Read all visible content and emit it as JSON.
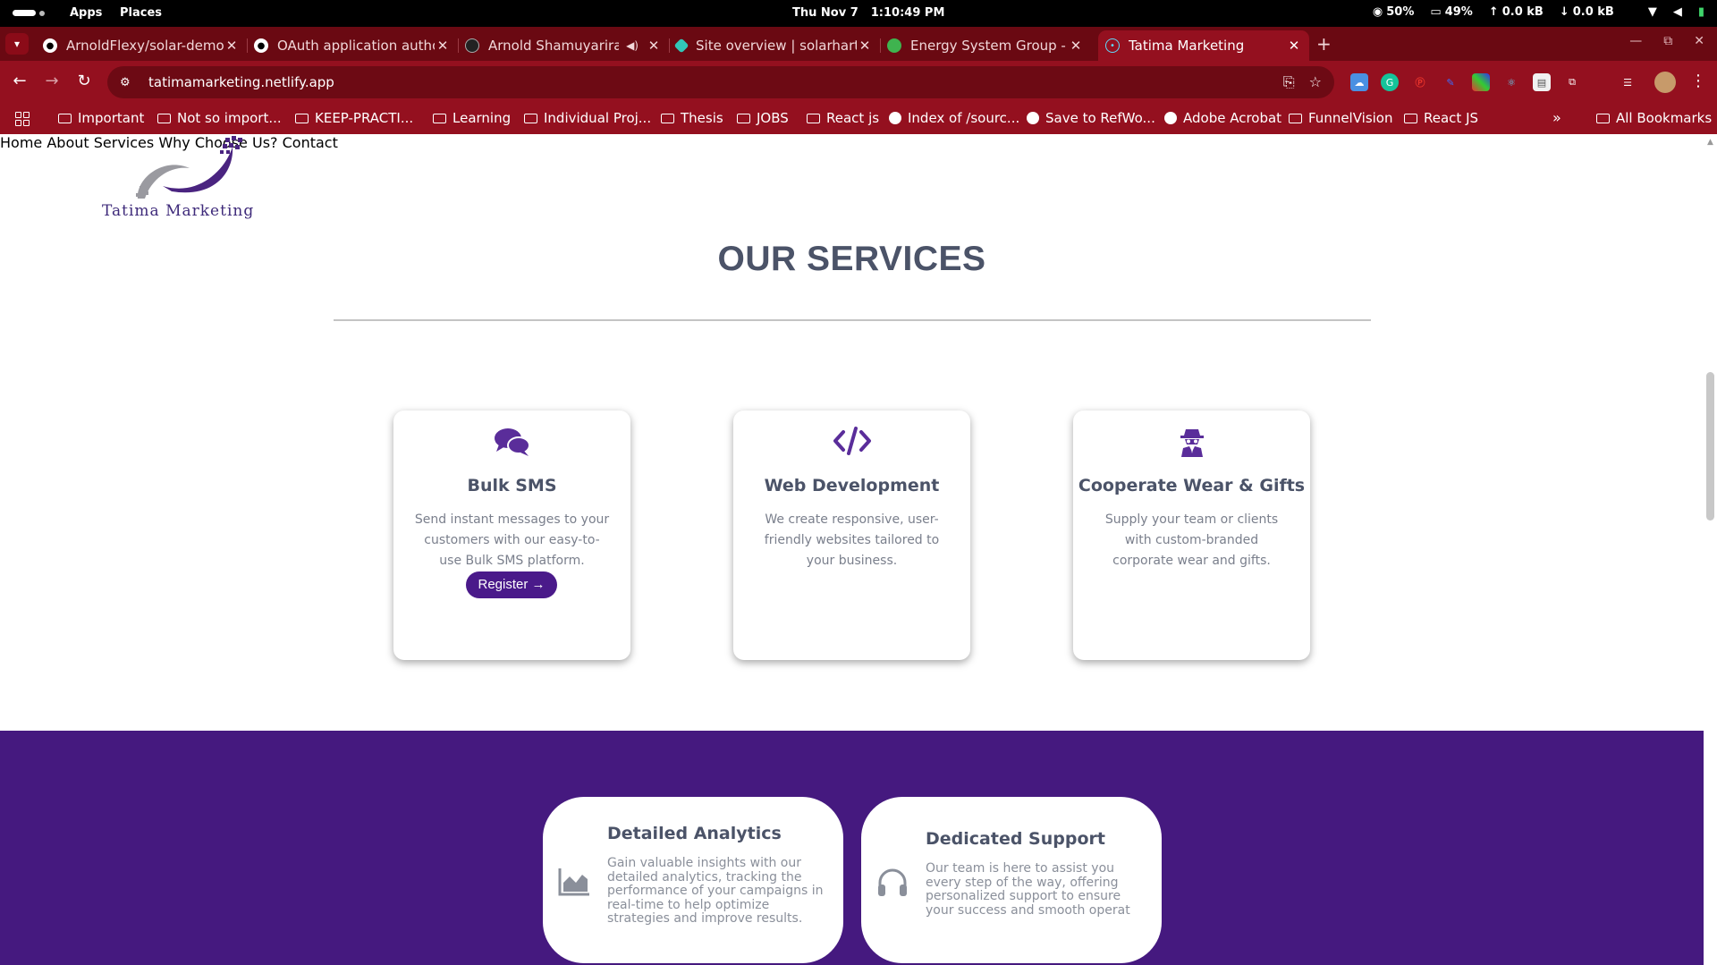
{
  "system_bar": {
    "apps": "Apps",
    "places": "Places",
    "date": "Thu Nov 7",
    "time": "1:10:49 PM",
    "cpu": "50%",
    "memory": "49%",
    "upload": "0.0 kB",
    "download": "0.0 kB"
  },
  "tabs": [
    {
      "label": "ArnoldFlexy/solar-demo",
      "icon": "github-icon",
      "active": false
    },
    {
      "label": "OAuth application authorization",
      "icon": "github-icon",
      "active": false
    },
    {
      "label": "Arnold Shamuyarira -",
      "icon": "globe-icon",
      "active": false,
      "audio": true
    },
    {
      "label": "Site overview | solarhart-",
      "icon": "netlify-icon",
      "active": false
    },
    {
      "label": "Energy System Group - S",
      "icon": "energy-icon",
      "active": false
    },
    {
      "label": "Tatima Marketing",
      "icon": "react-icon",
      "active": true
    }
  ],
  "toolbar": {
    "url": "tatimamarketing.netlify.app"
  },
  "bookmarks": [
    {
      "label": "Important",
      "type": "folder"
    },
    {
      "label": "Not so import...",
      "type": "folder"
    },
    {
      "label": "KEEP-PRACTI...",
      "type": "folder"
    },
    {
      "label": "Learning",
      "type": "folder"
    },
    {
      "label": "Individual Proj...",
      "type": "folder"
    },
    {
      "label": "Thesis",
      "type": "folder"
    },
    {
      "label": "JOBS",
      "type": "folder"
    },
    {
      "label": "React js",
      "type": "folder"
    },
    {
      "label": "Index of /sourc...",
      "type": "globe"
    },
    {
      "label": "Save to RefWo...",
      "type": "globe"
    },
    {
      "label": "Adobe Acrobat",
      "type": "globe"
    },
    {
      "label": "FunnelVision",
      "type": "folder"
    },
    {
      "label": "React JS",
      "type": "folder"
    }
  ],
  "all_bookmarks": "All Bookmarks",
  "site": {
    "logo_text": "Tatima Marketing",
    "nav": [
      "Home",
      "About",
      "Services",
      "Why Choose Us?",
      "Contact"
    ],
    "services_title": "OUR SERVICES",
    "services": [
      {
        "title": "Bulk SMS",
        "icon": "chat-bubbles-icon",
        "description": "Send instant messages to your customers with our easy-to-use Bulk SMS platform.",
        "button": "Register →"
      },
      {
        "title": "Web Development",
        "icon": "code-icon",
        "description": "We create responsive, user-friendly websites tailored to your business."
      },
      {
        "title": "Cooperate Wear & Gifts",
        "icon": "user-secret-icon",
        "description": "Supply your team or clients with custom-branded corporate wear and gifts."
      }
    ],
    "features": [
      {
        "title": "Detailed Analytics",
        "icon": "area-chart-icon",
        "description": "Gain valuable insights with our detailed analytics, tracking the performance of your campaigns in real-time to help optimize strategies and improve results."
      },
      {
        "title": "Dedicated Support",
        "icon": "headphones-icon",
        "description": "Our team is here to assist you every step of the way, offering personalized support to ensure your success and smooth operat"
      }
    ]
  },
  "colors": {
    "browser_frame": "#94101f",
    "tab_strip": "#6a0912",
    "brand_purple": "#45197f",
    "heading_gray": "#4b5368"
  }
}
